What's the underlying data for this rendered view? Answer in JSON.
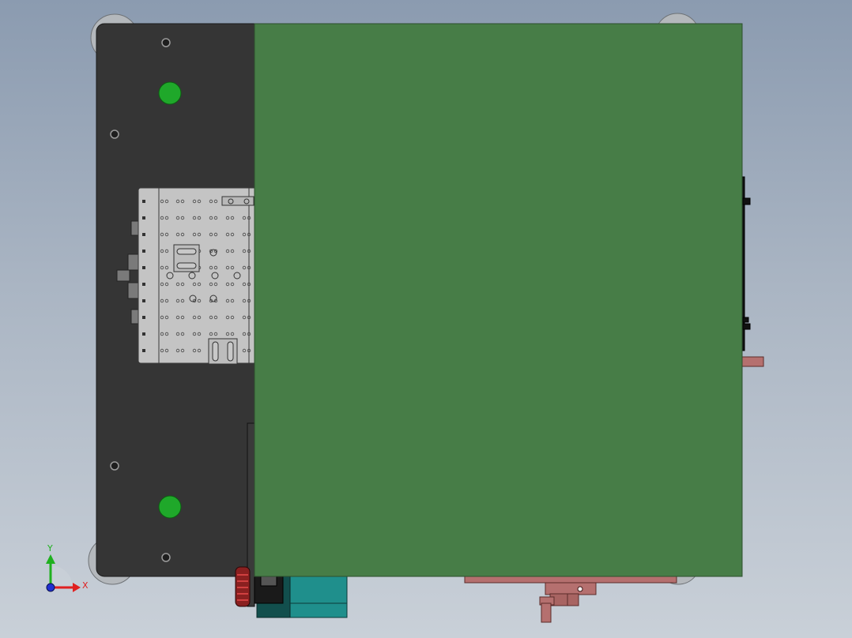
{
  "viewport": {
    "background_top": "#8b9bb0",
    "background_bottom": "#c9d0d8"
  },
  "colors": {
    "base_plate": "#353535",
    "cover_plate": "#477d47",
    "cover_edge": "#2d4f2d",
    "fixture_plate": "#c4c4c4",
    "green_marker": "#1fa82a",
    "motor_body": "#1f8f8c",
    "motor_dark": "#124f4d",
    "bracket": "#b5706f",
    "bracket_edge": "#5a2b2a"
  },
  "triad": {
    "x_label": "X",
    "y_label": "Y",
    "x_color": "#e02020",
    "y_color": "#1fb01f",
    "z_color": "#2030d0"
  }
}
